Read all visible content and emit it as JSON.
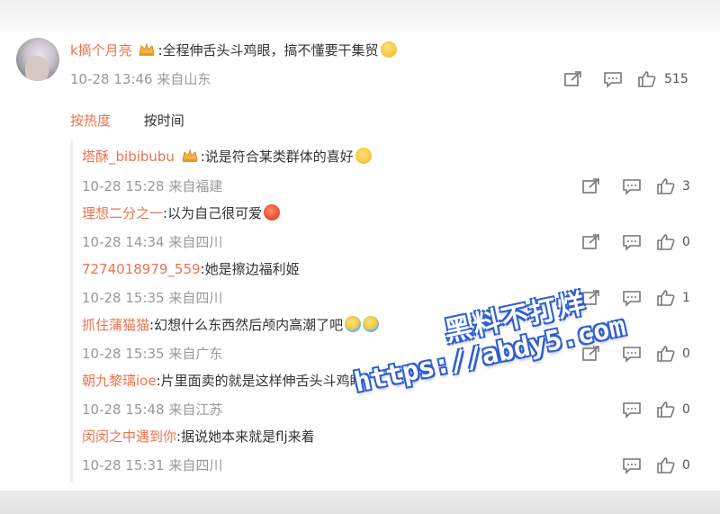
{
  "top_comment": {
    "username": "k摘个月亮",
    "text": ":全程伸舌头斗鸡眼，搞不懂要干集贸",
    "time": "10-28 13:46",
    "location": "来自山东",
    "likes": "515"
  },
  "tabs": {
    "hot": "按热度",
    "time": "按时间"
  },
  "replies": [
    {
      "username": "塔酥_bibibubu",
      "crown": true,
      "text": ":说是符合某类群体的喜好",
      "emoji": "yellow",
      "time": "10-28 15:28",
      "location": "来自福建",
      "likes": "3"
    },
    {
      "username": "理想二分之一",
      "crown": false,
      "text": ":以为自己很可爱",
      "emoji": "red",
      "time": "10-28 14:34",
      "location": "来自四川",
      "likes": "0"
    },
    {
      "username": "7274018979_559",
      "crown": false,
      "text": ":她是擦边福利姬",
      "emoji": "",
      "time": "10-28 15:35",
      "location": "来自四川",
      "likes": "1"
    },
    {
      "username": "抓住蒲猫猫",
      "crown": false,
      "text": ":幻想什么东西然后颅内高潮了吧",
      "emoji": "blue2",
      "time": "10-28 15:35",
      "location": "来自广东",
      "likes": "0"
    },
    {
      "username": "朝九黎璃ioe",
      "crown": false,
      "text": ":片里面卖的就是这样伸舌头斗鸡眼",
      "emoji": "",
      "time": "10-28 15:48",
      "location": "来自江苏",
      "likes": "0"
    },
    {
      "username": "闵闵之中遇到你",
      "crown": false,
      "text": ":据说她本来就是flj来着",
      "emoji": "",
      "time": "10-28 15:31",
      "location": "来自四川",
      "likes": "0"
    }
  ],
  "watermark": {
    "line1": "黑料不打烊",
    "line2": "https://abdy5.com"
  },
  "icons": [
    "share-icon",
    "comment-icon",
    "like-icon",
    "crown-icon"
  ],
  "colors": {
    "username": "#eb7350",
    "meta": "#999999",
    "watermark": "#2f5fd0"
  }
}
